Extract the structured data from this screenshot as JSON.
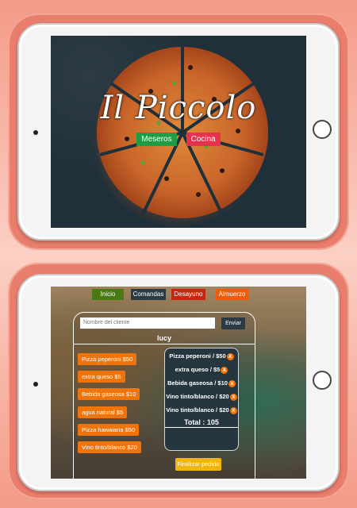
{
  "top_screen": {
    "logo": "Il Piccolo",
    "buttons": [
      {
        "label": "Meseros",
        "color": "#1e9d45"
      },
      {
        "label": "Cocina",
        "color": "#e7324d"
      }
    ]
  },
  "bottom_screen": {
    "nav": [
      {
        "label": "Inicio",
        "color": "#4b7a12"
      },
      {
        "label": "Comandas",
        "color": "#2b3a43"
      },
      {
        "label": "Desayuno",
        "color": "#c8260d"
      },
      {
        "label": "Almuerzo",
        "color": "#f05a0a"
      }
    ],
    "client_input_placeholder": "Nombre del cliente",
    "send_label": "Enviar",
    "client_name": "lucy",
    "menu_items": [
      "Pizza peperoni $50",
      "extra queso $5",
      "Bebida gaseosa $10",
      "agua natural $5",
      "Pizza hawaiana $50",
      "Vino tinto/blanco $20"
    ],
    "order_items": [
      "Pizza peperoni / $50",
      "extra queso / $5",
      "Bebida gaseosa / $10",
      "Vino tinto/blanco / $20",
      "Vino tinto/blanco / $20"
    ],
    "remove_label": "X",
    "total": "Total : 105",
    "finish_label": "Finalizar pedido"
  }
}
